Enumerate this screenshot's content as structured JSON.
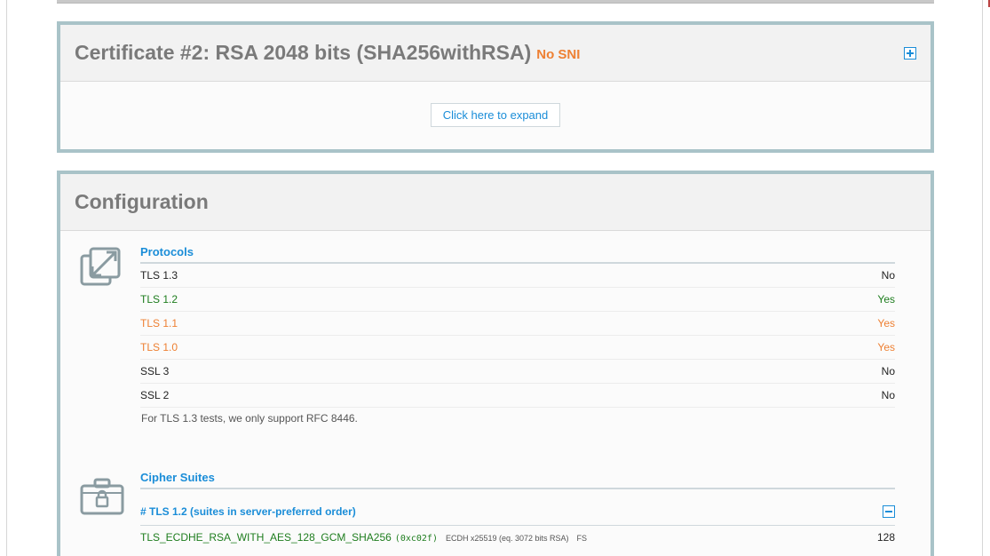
{
  "certificate": {
    "title": "Certificate #2: RSA 2048 bits (SHA256withRSA)",
    "badge": "No SNI",
    "expand_label": "Click here to expand"
  },
  "configuration": {
    "title": "Configuration",
    "protocols": {
      "title": "Protocols",
      "rows": [
        {
          "name": "TLS 1.3",
          "value": "No",
          "status": "dark"
        },
        {
          "name": "TLS 1.2",
          "value": "Yes",
          "status": "green"
        },
        {
          "name": "TLS 1.1",
          "value": "Yes",
          "status": "orange"
        },
        {
          "name": "TLS 1.0",
          "value": "Yes",
          "status": "orange"
        },
        {
          "name": "SSL 3",
          "value": "No",
          "status": "dark"
        },
        {
          "name": "SSL 2",
          "value": "No",
          "status": "dark"
        }
      ],
      "note": "For TLS 1.3 tests, we only support RFC 8446."
    },
    "cipher_suites": {
      "title": "Cipher Suites",
      "group_title": "# TLS 1.2 (suites in server-preferred order)",
      "suites": [
        {
          "name": "TLS_ECDHE_RSA_WITH_AES_128_GCM_SHA256",
          "code": "(0xc02f)",
          "kex": "ECDH x25519 (eq. 3072 bits RSA)",
          "fs": "FS",
          "bits": "128"
        }
      ]
    }
  },
  "colors": {
    "accent": "#1a8dd8",
    "good": "#1e7d1e",
    "warning": "#ee8033",
    "section_border": "#a9c3c8"
  }
}
